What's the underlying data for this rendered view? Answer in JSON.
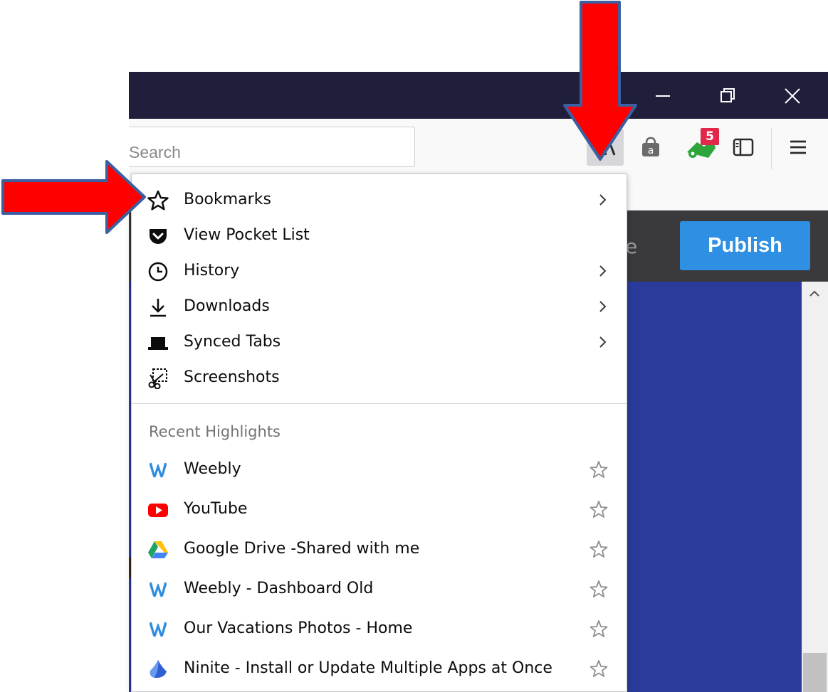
{
  "toolbar": {
    "search_placeholder": "Search",
    "badge_count": "5"
  },
  "page": {
    "publish_label": "Publish",
    "partial_text": "e"
  },
  "library_menu": {
    "items": [
      {
        "label": "Bookmarks",
        "icon": "star-outline-icon",
        "has_submenu": true
      },
      {
        "label": "View Pocket List",
        "icon": "pocket-icon",
        "has_submenu": false
      },
      {
        "label": "History",
        "icon": "clock-icon",
        "has_submenu": true
      },
      {
        "label": "Downloads",
        "icon": "download-icon",
        "has_submenu": true
      },
      {
        "label": "Synced Tabs",
        "icon": "synced-tabs-icon",
        "has_submenu": true
      },
      {
        "label": "Screenshots",
        "icon": "screenshots-icon",
        "has_submenu": false
      }
    ],
    "highlights_title": "Recent Highlights",
    "highlights": [
      {
        "label": "Weebly",
        "icon": "weebly-icon"
      },
      {
        "label": "YouTube",
        "icon": "youtube-icon"
      },
      {
        "label": "Google Drive -Shared with me",
        "icon": "google-drive-icon"
      },
      {
        "label": "Weebly - Dashboard Old",
        "icon": "weebly-icon"
      },
      {
        "label": "Our Vacations Photos - Home",
        "icon": "weebly-icon"
      },
      {
        "label": "Ninite - Install or Update Multiple Apps at Once",
        "icon": "ninite-icon"
      }
    ]
  },
  "colors": {
    "titlebar": "#1f1f3b",
    "publish": "#2f8fe3",
    "content_blue": "#2a3b9b",
    "arrow": "#ff0000",
    "badge": "#e1284a"
  }
}
